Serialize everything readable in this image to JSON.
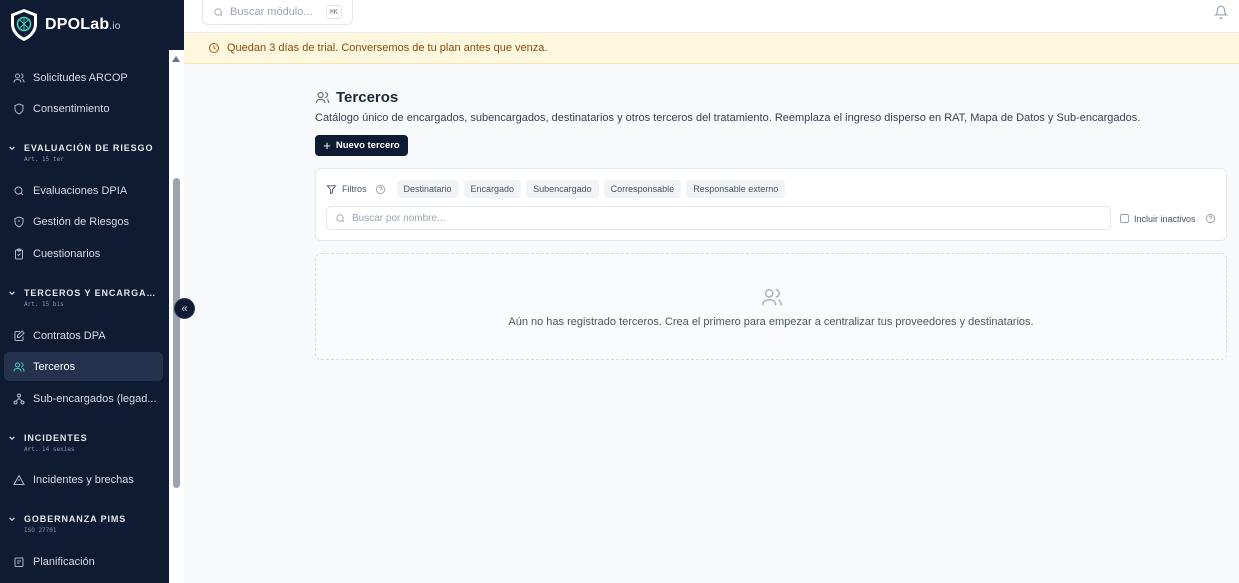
{
  "brand": {
    "name": "DPOLab",
    "suffix": ".io"
  },
  "sidebar": {
    "items": [
      {
        "label": "Solicitudes ARCOP",
        "icon": "users-icon"
      },
      {
        "label": "Consentimiento",
        "icon": "shield-icon"
      },
      {
        "label": "Evaluaciones DPIA",
        "icon": "search-icon"
      },
      {
        "label": "Gestión de Riesgos",
        "icon": "shield-alert-icon"
      },
      {
        "label": "Cuestionarios",
        "icon": "clipboard-icon"
      },
      {
        "label": "Contratos DPA",
        "icon": "file-edit-icon"
      },
      {
        "label": "Terceros",
        "icon": "users-icon",
        "active": true
      },
      {
        "label": "Sub-encargados (legad...",
        "icon": "network-icon"
      },
      {
        "label": "Incidentes y brechas",
        "icon": "alert-triangle-icon"
      },
      {
        "label": "Planificación",
        "icon": "calendar-icon"
      }
    ],
    "sections": [
      {
        "title": "EVALUACIÓN DE RIESGO",
        "sub": "Art. 15 ter"
      },
      {
        "title": "TERCEROS Y ENCARGADOS",
        "sub": "Art. 15 bis"
      },
      {
        "title": "INCIDENTES",
        "sub": "Art. 14 sexies"
      },
      {
        "title": "GOBERNANZA PIMS",
        "sub": "ISO 27701"
      }
    ],
    "collapse_label": "«"
  },
  "topbar": {
    "search_placeholder": "Buscar módulo...",
    "shortcut": "⌘K"
  },
  "trial": {
    "message": "Quedan 3 días de trial. Conversemos de tu plan antes que venza."
  },
  "main": {
    "title": "Terceros",
    "description": "Catálogo único de encargados, subencargados, destinatarios y otros terceros del tratamiento. Reemplaza el ingreso disperso en RAT, Mapa de Datos y Sub-encargados.",
    "new_button": "Nuevo tercero",
    "filters": {
      "label": "Filtros",
      "chips": [
        "Destinatario",
        "Encargado",
        "Subencargado",
        "Corresponsable",
        "Responsable externo"
      ],
      "search_placeholder": "Buscar por nombre...",
      "search_value": "",
      "include_inactive_label": "Incluir inactivos",
      "include_inactive_checked": false
    },
    "empty_message": "Aún no has registrado terceros. Crea el primero para empezar a centralizar tus proveedores y destinatarios."
  },
  "colors": {
    "sidebar_bg": "#0f1b33",
    "accent": "#3fd1b8",
    "trial_bg": "#fdf7dd",
    "trial_text": "#8a4a10"
  }
}
